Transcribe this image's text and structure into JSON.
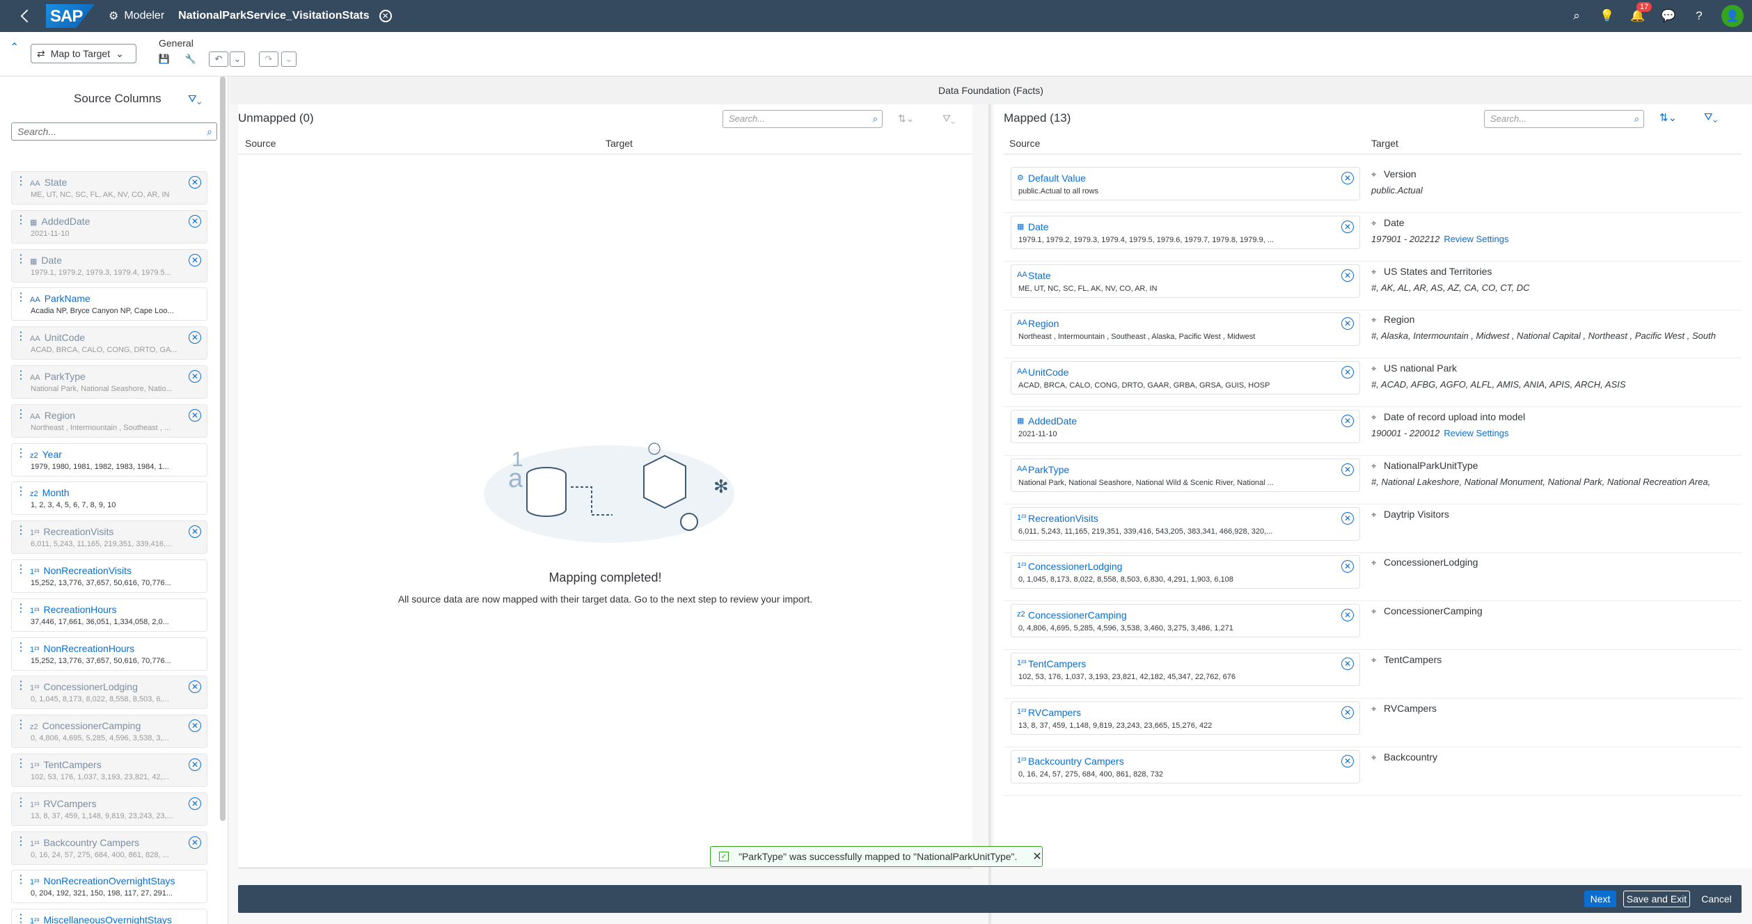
{
  "shell": {
    "app": "Modeler",
    "title": "NationalParkService_VisitationStats",
    "notifications": "17"
  },
  "toolbar": {
    "map_to_target": "Map to Target",
    "general": "General"
  },
  "subheader": "Data Foundation (Facts)",
  "left": {
    "title": "Source Columns",
    "search_placeholder": "Search...",
    "columns": [
      {
        "name": "State",
        "values": "ME, UT, NC, SC, FL, AK, NV, CO, AR, IN",
        "type": "AA",
        "mapped": true
      },
      {
        "name": "AddedDate",
        "values": "2021-11-10",
        "type": "cal",
        "mapped": true
      },
      {
        "name": "Date",
        "values": "1979.1, 1979.2, 1979.3, 1979.4, 1979.5...",
        "type": "cal",
        "mapped": true
      },
      {
        "name": "ParkName",
        "values": "Acadia NP, Bryce Canyon NP, Cape Loo...",
        "type": "AA",
        "mapped": false
      },
      {
        "name": "UnitCode",
        "values": "ACAD, BRCA, CALO, CONG, DRTO, GA...",
        "type": "AA",
        "mapped": true
      },
      {
        "name": "ParkType",
        "values": "National Park, National Seashore, Natio...",
        "type": "AA",
        "mapped": true
      },
      {
        "name": "Region",
        "values": "Northeast , Intermountain , Southeast , ...",
        "type": "AA",
        "mapped": true
      },
      {
        "name": "Year",
        "values": "1979, 1980, 1981, 1982, 1983, 1984, 1...",
        "type": "z2",
        "mapped": false
      },
      {
        "name": "Month",
        "values": "1, 2, 3, 4, 5, 6, 7, 8, 9, 10",
        "type": "z2",
        "mapped": false
      },
      {
        "name": "RecreationVisits",
        "values": "6,011, 5,243, 11,165, 219,351, 339,416,...",
        "type": "123",
        "mapped": true
      },
      {
        "name": "NonRecreationVisits",
        "values": "15,252, 13,776, 37,657, 50,616, 70,776...",
        "type": "123",
        "mapped": false
      },
      {
        "name": "RecreationHours",
        "values": "37,446, 17,661, 36,051, 1,334,058, 2,0...",
        "type": "123",
        "mapped": false
      },
      {
        "name": "NonRecreationHours",
        "values": "15,252, 13,776, 37,657, 50,616, 70,776...",
        "type": "123",
        "mapped": false
      },
      {
        "name": "ConcessionerLodging",
        "values": "0, 1,045, 8,173, 8,022, 8,558, 8,503, 6,...",
        "type": "123",
        "mapped": true
      },
      {
        "name": "ConcessionerCamping",
        "values": "0, 4,806, 4,695, 5,285, 4,596, 3,538, 3,...",
        "type": "z2",
        "mapped": true
      },
      {
        "name": "TentCampers",
        "values": "102, 53, 176, 1,037, 3,193, 23,821, 42,...",
        "type": "123",
        "mapped": true
      },
      {
        "name": "RVCampers",
        "values": "13, 8, 37, 459, 1,148, 9,819, 23,243, 23,...",
        "type": "123",
        "mapped": true
      },
      {
        "name": "Backcountry Campers",
        "values": "0, 16, 24, 57, 275, 684, 400, 861, 828, ...",
        "type": "123",
        "mapped": true
      },
      {
        "name": "NonRecreationOvernightStays",
        "values": "0, 204, 192, 321, 150, 198, 117, 27, 291...",
        "type": "123",
        "mapped": false
      },
      {
        "name": "MiscellaneousOvernightStays",
        "values": "",
        "type": "123",
        "mapped": false
      }
    ]
  },
  "unmapped": {
    "title": "Unmapped (0)",
    "search_placeholder": "Search...",
    "col_source": "Source",
    "col_target": "Target",
    "message": "Mapping completed!",
    "sub": "All source data are now mapped with their target data. Go to the next step to review your import."
  },
  "mapped": {
    "title": "Mapped (13)",
    "search_placeholder": "Search...",
    "col_source": "Source",
    "col_target": "Target",
    "rows": [
      {
        "source": "Default Value",
        "values": "public.Actual to all rows",
        "type": "dv",
        "target": "Version",
        "tvals": "public.Actual",
        "link": ""
      },
      {
        "source": "Date",
        "values": "1979.1, 1979.2, 1979.3, 1979.4, 1979.5, 1979.6, 1979.7, 1979.8, 1979.9, ...",
        "type": "cal",
        "target": "Date",
        "tvals": "197901 - 202212",
        "link": "Review Settings"
      },
      {
        "source": "State",
        "values": "ME, UT, NC, SC, FL, AK, NV, CO, AR, IN",
        "type": "AA",
        "target": "US States and Territories",
        "tvals": "#, AK, AL, AR, AS, AZ, CA, CO, CT, DC",
        "link": ""
      },
      {
        "source": "Region",
        "values": "Northeast , Intermountain , Southeast , Alaska, Pacific West , Midwest",
        "type": "AA",
        "target": "Region",
        "tvals": "#, Alaska, Intermountain , Midwest , National Capital , Northeast , Pacific West , South",
        "link": ""
      },
      {
        "source": "UnitCode",
        "values": "ACAD, BRCA, CALO, CONG, DRTO, GAAR, GRBA, GRSA, GUIS, HOSP",
        "type": "AA",
        "target": "US national Park",
        "tvals": "#, ACAD, AFBG, AGFO, ALFL, AMIS, ANIA, APIS, ARCH, ASIS",
        "link": ""
      },
      {
        "source": "AddedDate",
        "values": "2021-11-10",
        "type": "cal",
        "target": "Date of record upload into model",
        "tvals": "190001 - 220012",
        "link": "Review Settings"
      },
      {
        "source": "ParkType",
        "values": "National Park, National Seashore, National Wild & Scenic River, National ...",
        "type": "AA",
        "target": "NationalParkUnitType",
        "tvals": "#, National Lakeshore, National Monument, National Park, National Recreation Area,",
        "link": ""
      },
      {
        "source": "RecreationVisits",
        "values": "6,011, 5,243, 11,165, 219,351, 339,416, 543,205, 383,341, 466,928, 320,...",
        "type": "123",
        "target": "Daytrip Visitors",
        "tvals": "",
        "link": ""
      },
      {
        "source": "ConcessionerLodging",
        "values": "0, 1,045, 8,173, 8,022, 8,558, 8,503, 6,830, 4,291, 1,903, 6,108",
        "type": "123",
        "target": "ConcessionerLodging",
        "tvals": "",
        "link": ""
      },
      {
        "source": "ConcessionerCamping",
        "values": "0, 4,806, 4,695, 5,285, 4,596, 3,538, 3,460, 3,275, 3,486, 1,271",
        "type": "z2",
        "target": "ConcessionerCamping",
        "tvals": "",
        "link": ""
      },
      {
        "source": "TentCampers",
        "values": "102, 53, 176, 1,037, 3,193, 23,821, 42,182, 45,347, 22,762, 676",
        "type": "123",
        "target": "TentCampers",
        "tvals": "",
        "link": ""
      },
      {
        "source": "RVCampers",
        "values": "13, 8, 37, 459, 1,148, 9,819, 23,243, 23,665, 15,276, 422",
        "type": "123",
        "target": "RVCampers",
        "tvals": "",
        "link": ""
      },
      {
        "source": "Backcountry Campers",
        "values": "0, 16, 24, 57, 275, 684, 400, 861, 828, 732",
        "type": "123",
        "target": "Backcountry",
        "tvals": "",
        "link": ""
      }
    ]
  },
  "toast": "\"ParkType\" was successfully mapped to \"NationalParkUnitType\".",
  "footer": {
    "next": "Next",
    "save_exit": "Save and Exit",
    "cancel": "Cancel"
  }
}
